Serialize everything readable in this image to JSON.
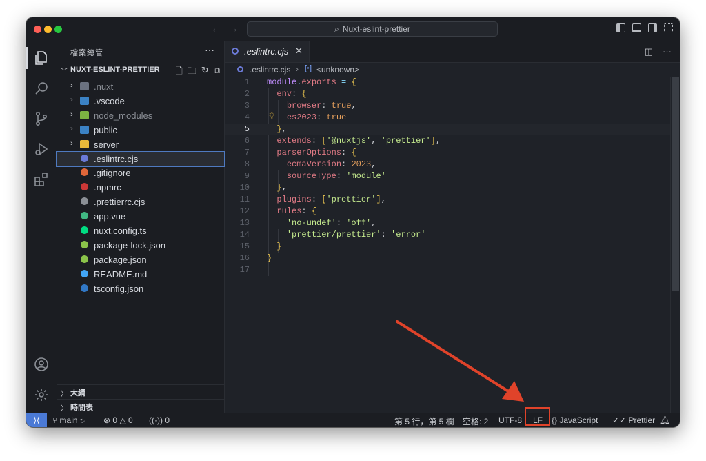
{
  "titlebar": {
    "search_text": "Nuxt-eslint-prettier"
  },
  "sidebar": {
    "title": "檔案總管",
    "more": "···",
    "project_name": "NUXT-ESLINT-PRETTIER",
    "tree": [
      {
        "label": ".nuxt",
        "type": "folder",
        "icon_color": "#6b7280",
        "dim": true
      },
      {
        "label": ".vscode",
        "type": "folder",
        "icon_color": "#3b82c4",
        "dim": false
      },
      {
        "label": "node_modules",
        "type": "folder",
        "icon_color": "#7cb342",
        "dim": true
      },
      {
        "label": "public",
        "type": "folder",
        "icon_color": "#3b82c4",
        "dim": false
      },
      {
        "label": "server",
        "type": "folder",
        "icon_color": "#e8b83a",
        "dim": false
      },
      {
        "label": ".eslintrc.cjs",
        "type": "file",
        "icon_color": "#6b7ad6",
        "dim": false
      },
      {
        "label": ".gitignore",
        "type": "file",
        "icon_color": "#e0673a",
        "dim": false
      },
      {
        "label": ".npmrc",
        "type": "file",
        "icon_color": "#cb3837",
        "dim": false
      },
      {
        "label": ".prettierrc.cjs",
        "type": "file",
        "icon_color": "#8b8f96",
        "dim": false
      },
      {
        "label": "app.vue",
        "type": "file",
        "icon_color": "#41b883",
        "dim": false
      },
      {
        "label": "nuxt.config.ts",
        "type": "file",
        "icon_color": "#00dc82",
        "dim": false
      },
      {
        "label": "package-lock.json",
        "type": "file",
        "icon_color": "#8bc34a",
        "dim": false
      },
      {
        "label": "package.json",
        "type": "file",
        "icon_color": "#8bc34a",
        "dim": false
      },
      {
        "label": "README.md",
        "type": "file",
        "icon_color": "#42a5f5",
        "dim": false
      },
      {
        "label": "tsconfig.json",
        "type": "file",
        "icon_color": "#3178c6",
        "dim": false
      }
    ],
    "sections": [
      "大綱",
      "時間表"
    ]
  },
  "editor": {
    "tab_label": ".eslintrc.cjs",
    "tab_close": "✕",
    "breadcrumb_file": ".eslintrc.cjs",
    "breadcrumb_symbol": "<unknown>",
    "current_line": 5,
    "lines": [
      "module.exports = {",
      "  env: {",
      "    browser: true,",
      "    es2023: true",
      "  },",
      "  extends: ['@nuxtjs', 'prettier'],",
      "  parserOptions: {",
      "    ecmaVersion: 2023,",
      "    sourceType: 'module'",
      "  },",
      "  plugins: ['prettier'],",
      "  rules: {",
      "    'no-undef': 'off',",
      "    'prettier/prettier': 'error'",
      "  }",
      "}",
      ""
    ]
  },
  "statusbar": {
    "remote_icon": "⟩⟨",
    "branch": "main",
    "errors": "0",
    "warnings": "0",
    "ports": "0",
    "position": "第 5 行，第 5 欄",
    "spaces": "空格: 2",
    "encoding": "UTF-8",
    "eol": "LF",
    "language": "JavaScript",
    "formatter": "Prettier"
  },
  "colors": {
    "annotation": "#e0432a",
    "accent": "#4b7ad6"
  }
}
